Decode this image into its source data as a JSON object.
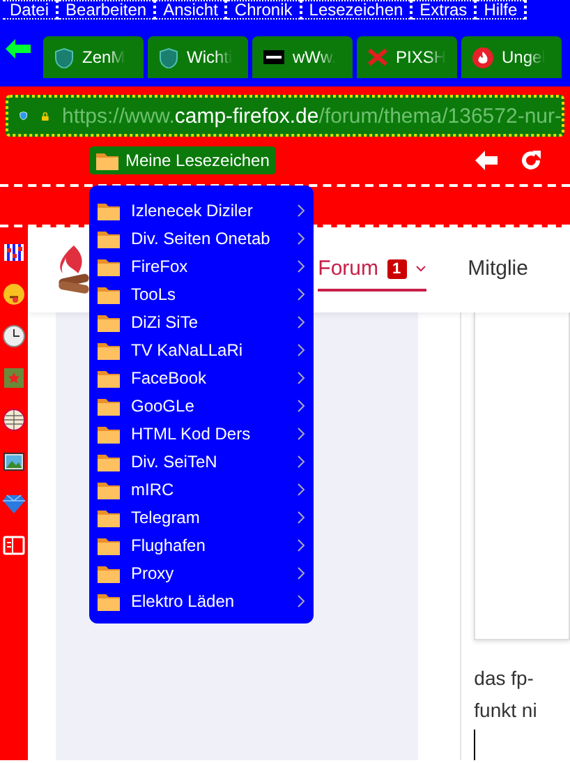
{
  "menu_bar": [
    "Datei",
    "Bearbeiten",
    "Ansicht",
    "Chronik",
    "Lesezeichen",
    "Extras",
    "Hilfe"
  ],
  "tabs": [
    {
      "title": "ZenM"
    },
    {
      "title": "Wichti"
    },
    {
      "title": "wWw."
    },
    {
      "title": "PIXSH"
    },
    {
      "title": "Ungel"
    }
  ],
  "address_bar": {
    "prefix": "https://www.",
    "domain": "camp-firefox.de",
    "path": "/forum/thema/136572-nur-"
  },
  "bookmarks_button": "Meine Lesezeichen",
  "bookmarks_menu": [
    "Izlenecek Diziler",
    "Div. Seiten Onetab",
    "FireFox",
    "TooLs",
    "DiZi SiTe",
    "TV KaNaLLaRi",
    "FaceBook",
    "GooGLe",
    "HTML Kod Ders",
    "Div. SeiTeN",
    "mIRC",
    "Telegram",
    "Flughafen",
    "Proxy",
    "Elektro Läden"
  ],
  "site_nav": [
    {
      "label": "Forum",
      "badge": "1",
      "selected": true
    },
    {
      "label": "Mitglie",
      "selected": false
    }
  ],
  "post_text": [
    "das fp-",
    "funkt ni"
  ]
}
